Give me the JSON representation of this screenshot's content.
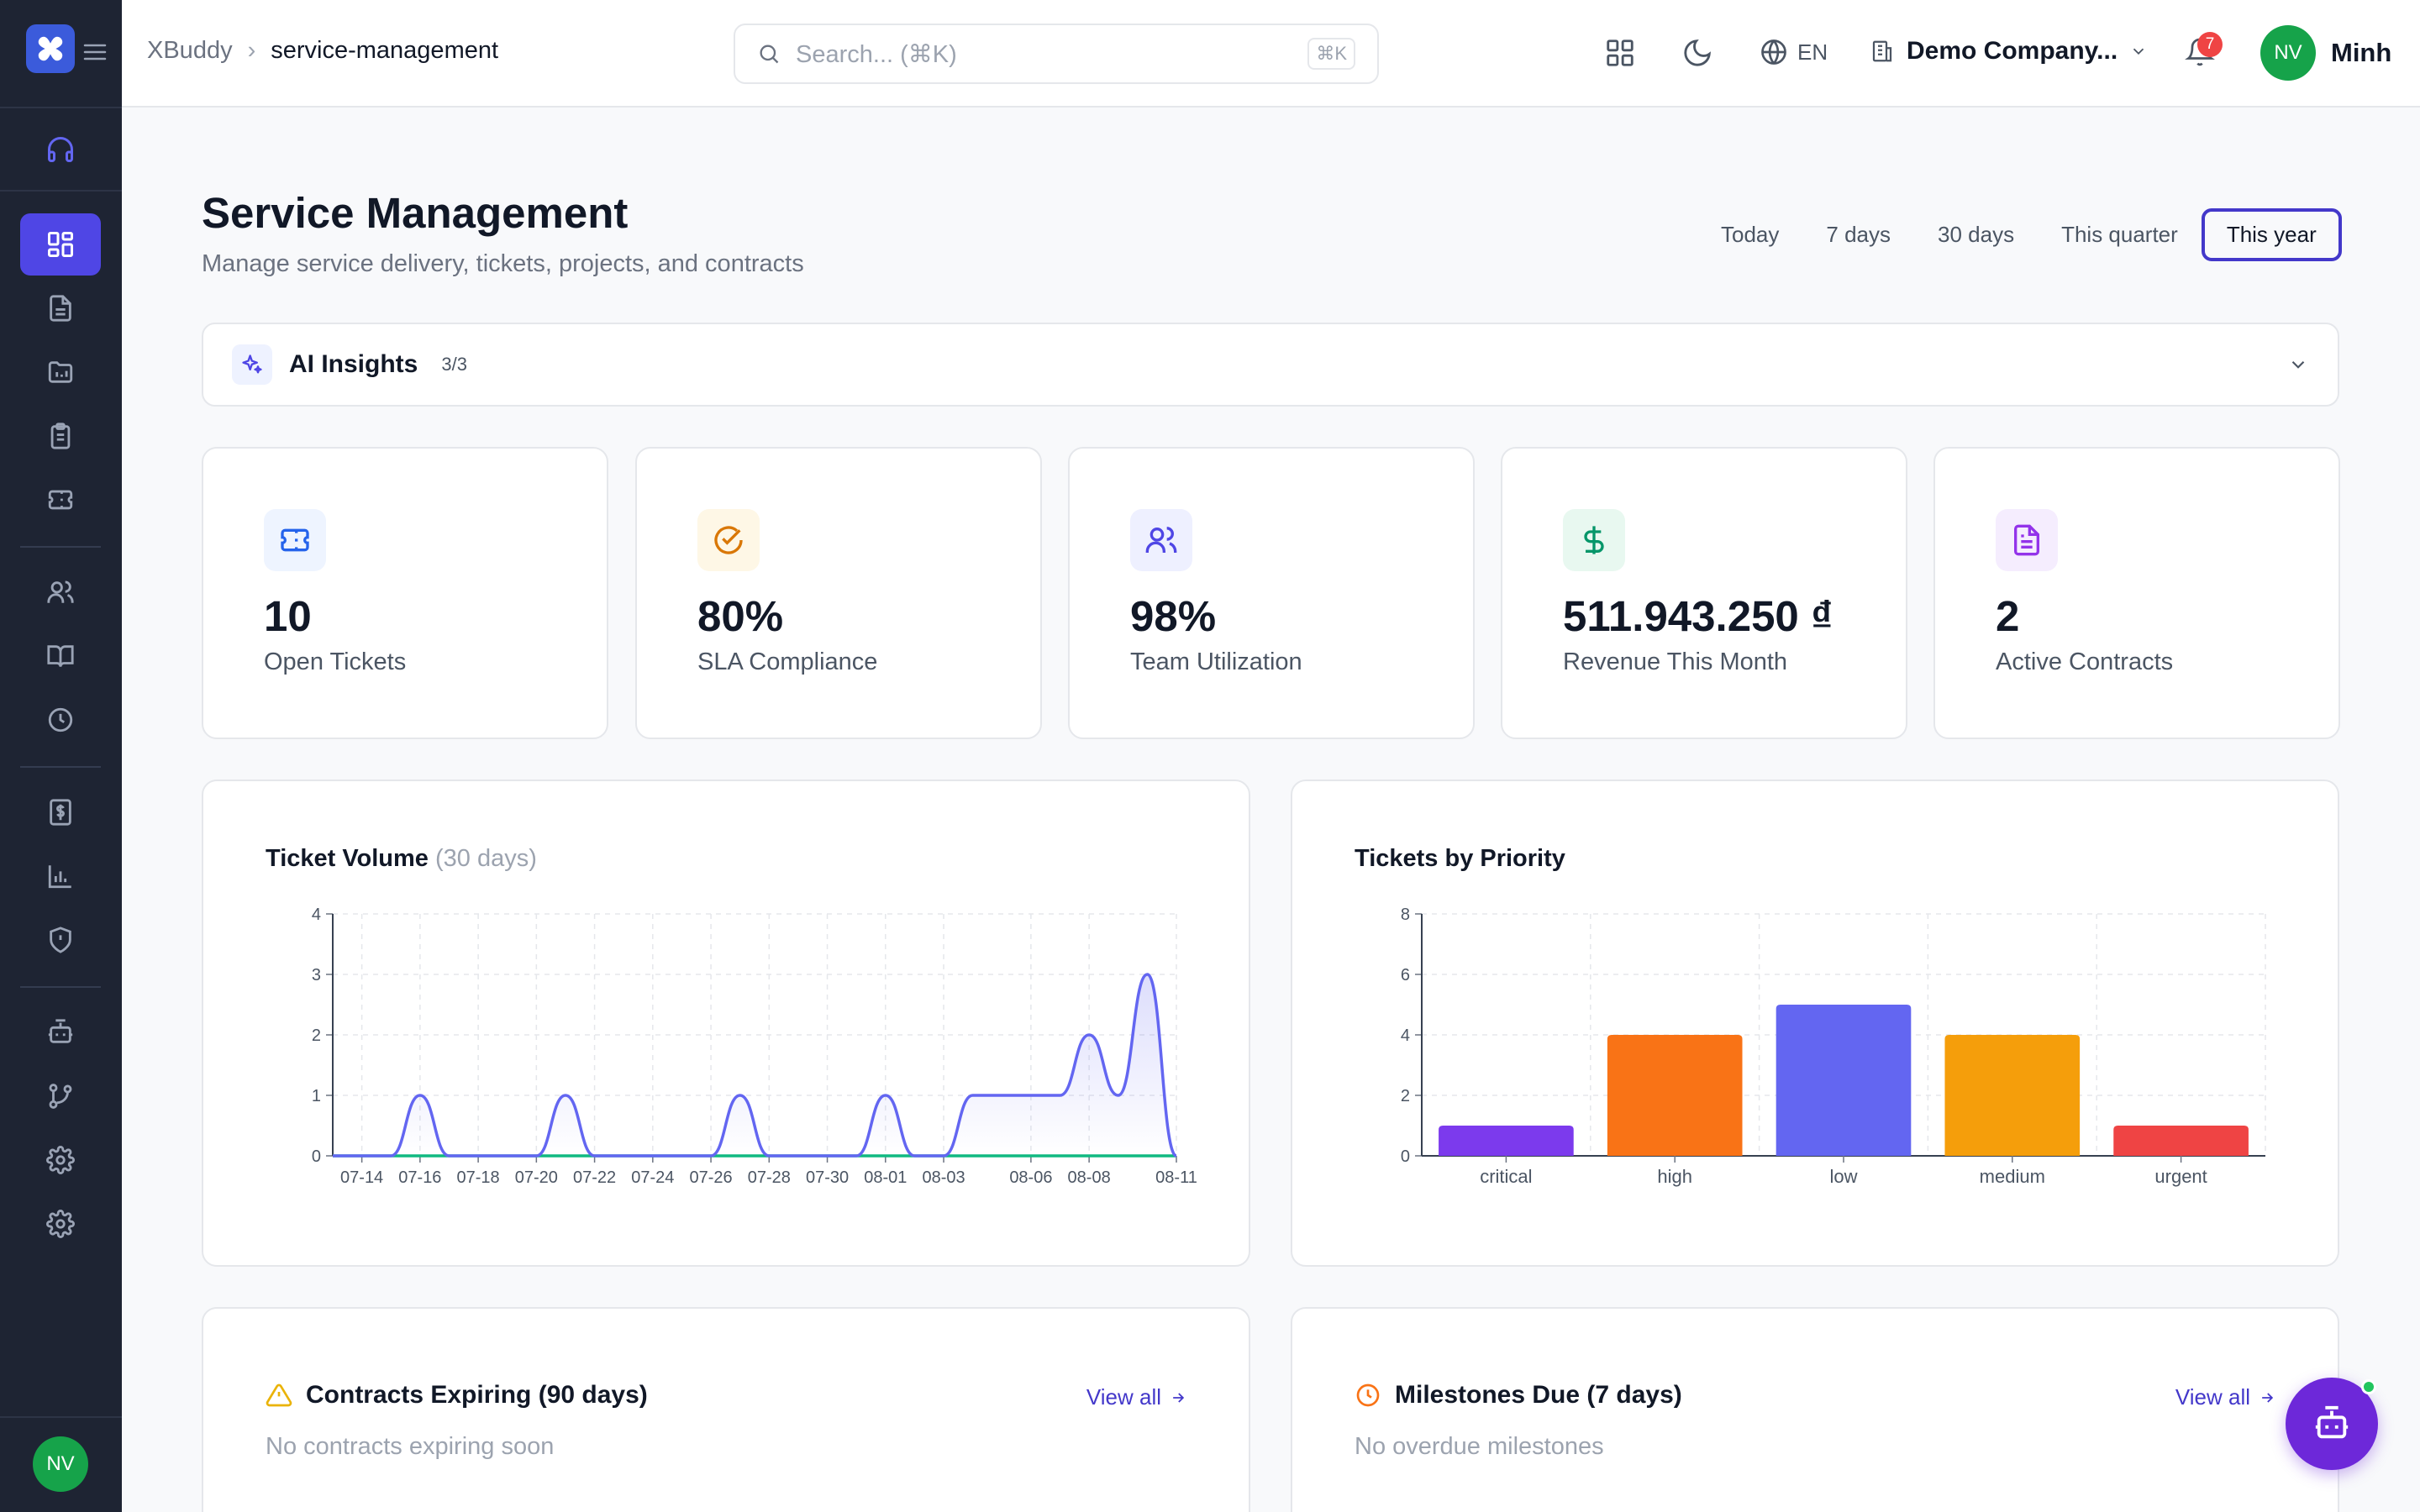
{
  "breadcrumb": {
    "root": "XBuddy",
    "separator": "›",
    "current": "service-management"
  },
  "search": {
    "placeholder": "Search... (⌘K)",
    "shortcut": "⌘K"
  },
  "topbar": {
    "language": "EN",
    "company": "Demo Company...",
    "notifications_count": "7",
    "user_initials": "NV",
    "user_name": "Minh"
  },
  "sidebar": {
    "user_initials": "NV",
    "items": [
      {
        "icon": "headphones-icon"
      },
      {
        "icon": "dashboard-grid-icon",
        "active": true
      },
      {
        "icon": "document-icon"
      },
      {
        "icon": "folder-icon"
      },
      {
        "icon": "clipboard-icon"
      },
      {
        "icon": "ticket-icon"
      },
      {
        "icon": "users-icon"
      },
      {
        "icon": "book-icon"
      },
      {
        "icon": "clock-icon"
      },
      {
        "icon": "invoice-dollar-icon"
      },
      {
        "icon": "bar-chart-icon"
      },
      {
        "icon": "shield-alert-icon"
      },
      {
        "icon": "bot-icon"
      },
      {
        "icon": "git-branch-icon"
      },
      {
        "icon": "gear-icon"
      },
      {
        "icon": "gear-icon"
      }
    ]
  },
  "header": {
    "title": "Service Management",
    "subtitle": "Manage service delivery, tickets, projects, and contracts"
  },
  "periods": [
    "Today",
    "7 days",
    "30 days",
    "This quarter",
    "This year"
  ],
  "active_period": "This year",
  "ai_insights": {
    "label": "AI Insights",
    "count": "3/3"
  },
  "kpis": [
    {
      "value": "10",
      "label": "Open Tickets",
      "icon": "ticket-icon",
      "color": "#2563eb",
      "bg": "#eef4ff"
    },
    {
      "value": "80%",
      "label": "SLA Compliance",
      "icon": "check-circle-icon",
      "color": "#d97706",
      "bg": "#fef7e6"
    },
    {
      "value": "98%",
      "label": "Team Utilization",
      "icon": "users-icon",
      "color": "#4f46e5",
      "bg": "#eef0ff"
    },
    {
      "value": "511.943.250 ₫",
      "label": "Revenue This Month",
      "icon": "dollar-icon",
      "color": "#059669",
      "bg": "#e8f8f0"
    },
    {
      "value": "2",
      "label": "Active Contracts",
      "icon": "file-text-icon",
      "color": "#9333ea",
      "bg": "#f5edfe"
    }
  ],
  "ticket_volume": {
    "title": "Ticket Volume",
    "title_suffix": "(30 days)"
  },
  "tickets_by_priority": {
    "title": "Tickets by Priority"
  },
  "chart_data": [
    {
      "type": "line",
      "title": "Ticket Volume (30 days)",
      "xlabel": "",
      "ylabel": "",
      "ylim": [
        0,
        4
      ],
      "yticks": [
        0,
        1,
        2,
        3,
        4
      ],
      "grid": true,
      "x": [
        "07-13",
        "07-14",
        "07-15",
        "07-16",
        "07-17",
        "07-18",
        "07-19",
        "07-20",
        "07-21",
        "07-22",
        "07-23",
        "07-24",
        "07-25",
        "07-26",
        "07-27",
        "07-28",
        "07-29",
        "07-30",
        "07-31",
        "08-01",
        "08-02",
        "08-03",
        "08-04",
        "08-05",
        "08-06",
        "08-07",
        "08-08",
        "08-09",
        "08-10",
        "08-11"
      ],
      "xtick_labels": [
        "07-14",
        "07-16",
        "07-18",
        "07-20",
        "07-22",
        "07-24",
        "07-26",
        "07-28",
        "07-30",
        "08-01",
        "08-03",
        "08-06",
        "08-08",
        "08-11"
      ],
      "series": [
        {
          "color": "#6366f1",
          "values": [
            0,
            0,
            0,
            1,
            0,
            0,
            0,
            0,
            1,
            0,
            0,
            0,
            0,
            0,
            1,
            0,
            0,
            0,
            0,
            1,
            0,
            0,
            1,
            1,
            1,
            1,
            2,
            1,
            3,
            0
          ]
        },
        {
          "color": "#10b981",
          "values": [
            0,
            0,
            0,
            0,
            0,
            0,
            0,
            0,
            0,
            0,
            0,
            0,
            0,
            0,
            0,
            0,
            0,
            0,
            0,
            0,
            0,
            0,
            0,
            0,
            0,
            0,
            0,
            0,
            0,
            0
          ]
        }
      ]
    },
    {
      "type": "bar",
      "title": "Tickets by Priority",
      "xlabel": "",
      "ylabel": "",
      "ylim": [
        0,
        8
      ],
      "yticks": [
        0,
        2,
        4,
        6,
        8
      ],
      "grid": true,
      "categories": [
        "critical",
        "high",
        "low",
        "medium",
        "urgent"
      ],
      "values": [
        1,
        4,
        5,
        4,
        1
      ],
      "colors": [
        "#7c3aed",
        "#f97316",
        "#6366f1",
        "#f59e0b",
        "#ef4444"
      ]
    }
  ],
  "contracts": {
    "title": "Contracts Expiring (90 days)",
    "view_all": "View all",
    "empty": "No contracts expiring soon"
  },
  "milestones": {
    "title": "Milestones Due (7 days)",
    "view_all": "View all",
    "empty": "No overdue milestones"
  }
}
